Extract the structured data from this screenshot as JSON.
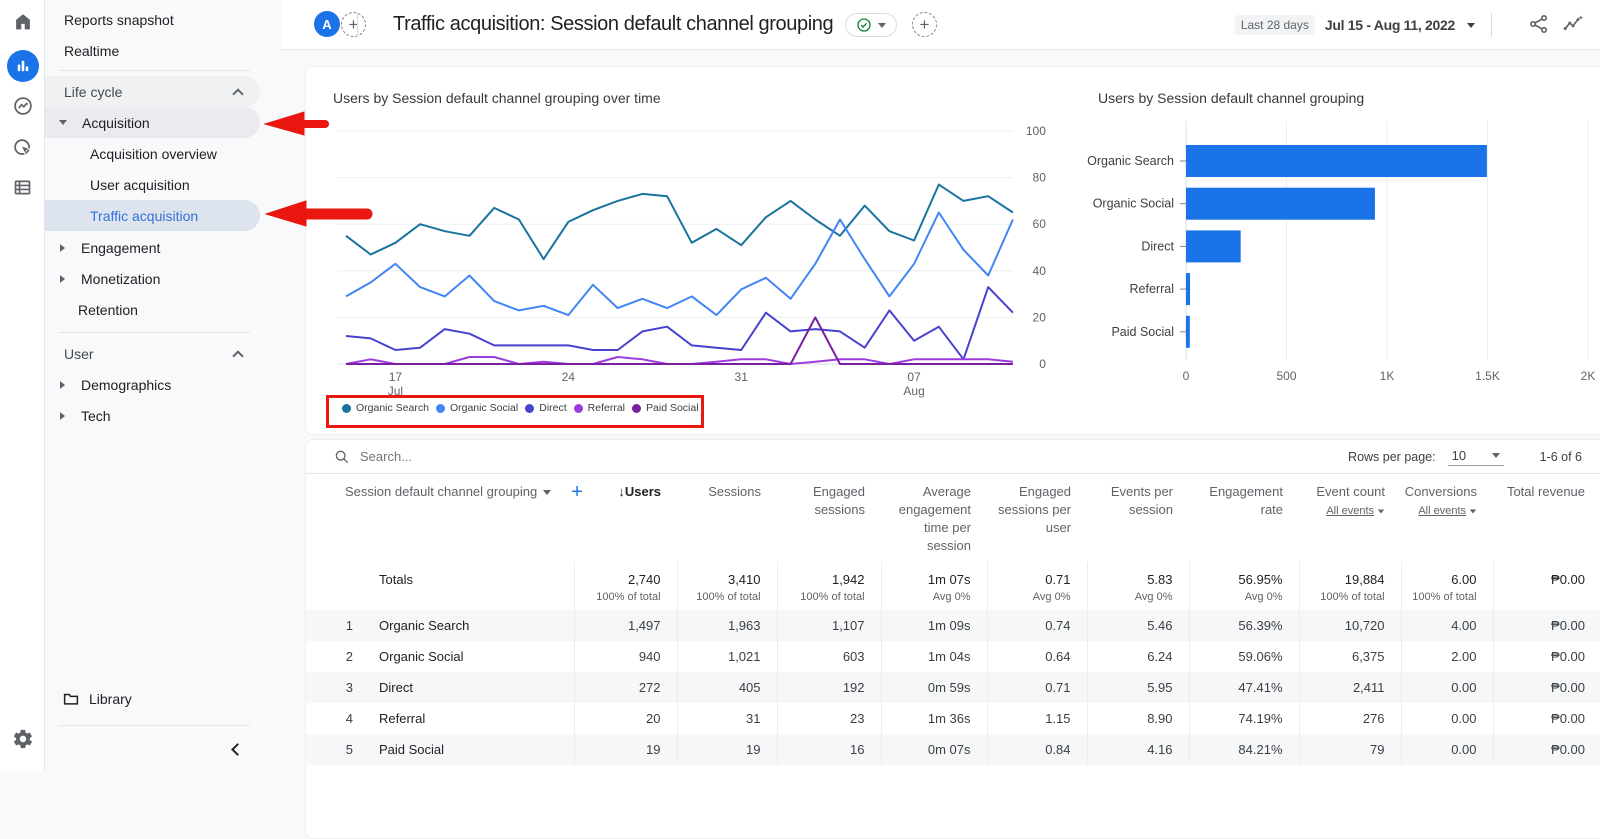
{
  "rail": {
    "icons": [
      {
        "name": "home"
      },
      {
        "name": "reports",
        "selected": true
      },
      {
        "name": "explore"
      },
      {
        "name": "advertising"
      },
      {
        "name": "configure"
      }
    ],
    "settings_icon": "admin-gear"
  },
  "sidebar": {
    "items": [
      {
        "label": "Reports snapshot"
      },
      {
        "label": "Realtime"
      },
      {
        "label": "Life cycle",
        "kind": "section"
      },
      {
        "label": "Acquisition",
        "kind": "group-expanded"
      },
      {
        "label": "Acquisition overview",
        "kind": "child"
      },
      {
        "label": "User acquisition",
        "kind": "child"
      },
      {
        "label": "Traffic acquisition",
        "kind": "child-selected"
      },
      {
        "label": "Engagement",
        "kind": "group"
      },
      {
        "label": "Monetization",
        "kind": "group"
      },
      {
        "label": "Retention",
        "kind": "plain"
      },
      {
        "label": "User",
        "kind": "section"
      },
      {
        "label": "Demographics",
        "kind": "group"
      },
      {
        "label": "Tech",
        "kind": "group"
      }
    ],
    "library_label": "Library"
  },
  "header": {
    "avatar_letter": "A",
    "title": "Traffic acquisition: Session default channel grouping",
    "date_chip": "Last 28 days",
    "date_range": "Jul 15 - Aug 11, 2022"
  },
  "chart_data": [
    {
      "type": "line",
      "title": "Users by Session default channel grouping over time",
      "ylabel": "",
      "ylim": [
        0,
        100
      ],
      "yticks": [
        0,
        20,
        40,
        60,
        80,
        100
      ],
      "x_days": 28,
      "x_ticks": [
        {
          "day": 2,
          "line1": "17",
          "line2": "Jul"
        },
        {
          "day": 9,
          "line1": "24",
          "line2": ""
        },
        {
          "day": 16,
          "line1": "31",
          "line2": ""
        },
        {
          "day": 23,
          "line1": "07",
          "line2": "Aug"
        }
      ],
      "legend_position": "bottom",
      "grid": true,
      "series": [
        {
          "name": "Organic Search",
          "color": "#18739e",
          "values": [
            55,
            47,
            52,
            60,
            57,
            55,
            67,
            62,
            45,
            61,
            66,
            70,
            73,
            72,
            52,
            58,
            51,
            63,
            70,
            62,
            55,
            68,
            57,
            53,
            77,
            70,
            72,
            65
          ]
        },
        {
          "name": "Organic Social",
          "color": "#4285f4",
          "values": [
            29,
            35,
            43,
            33,
            29,
            38,
            27,
            23,
            25,
            21,
            34,
            24,
            28,
            24,
            29,
            21,
            32,
            37,
            28,
            43,
            62,
            45,
            29,
            43,
            65,
            49,
            38,
            62
          ]
        },
        {
          "name": "Direct",
          "color": "#4742d0",
          "values": [
            12,
            11,
            6,
            7,
            15,
            13,
            8,
            8,
            8,
            8,
            6,
            6,
            14,
            16,
            8,
            7,
            6,
            22,
            14,
            15,
            14,
            7,
            23,
            10,
            16,
            2,
            33,
            22
          ]
        },
        {
          "name": "Referral",
          "color": "#9c3ce0",
          "values": [
            0,
            2,
            0,
            0,
            0,
            3,
            3,
            0,
            1,
            0,
            0,
            3,
            2,
            0,
            0,
            1,
            2,
            2,
            0,
            1,
            2,
            2,
            0,
            2,
            2,
            2,
            2,
            1
          ]
        },
        {
          "name": "Paid Social",
          "color": "#7b1fa2",
          "values": [
            0,
            0,
            0,
            0,
            0,
            0,
            0,
            0,
            0,
            0,
            0,
            0,
            0,
            0,
            0,
            0,
            0,
            0,
            0,
            20,
            0,
            0,
            0,
            0,
            0,
            0,
            0,
            0
          ]
        }
      ]
    },
    {
      "type": "bar",
      "title": "Users by Session default channel grouping",
      "categories": [
        "Organic Search",
        "Organic Social",
        "Direct",
        "Referral",
        "Paid Social"
      ],
      "values": [
        1497,
        940,
        272,
        20,
        19
      ],
      "bar_color": "#1a73e8",
      "xlim": [
        0,
        2000
      ],
      "x_ticks": [
        {
          "v": 0,
          "label": "0"
        },
        {
          "v": 500,
          "label": "500"
        },
        {
          "v": 1000,
          "label": "1K"
        },
        {
          "v": 1500,
          "label": "1.5K"
        },
        {
          "v": 2000,
          "label": "2K"
        }
      ],
      "grid": true
    }
  ],
  "table": {
    "search_placeholder": "Search...",
    "rows_per_page_label": "Rows per page:",
    "rows_per_page_value": "10",
    "range_label": "1-6 of 6",
    "dim_header": "Session default channel grouping",
    "columns": [
      {
        "label": "↓Users",
        "sorted": true
      },
      {
        "label": "Sessions"
      },
      {
        "label": "Engaged sessions"
      },
      {
        "label": "Average engagement time per session"
      },
      {
        "label": "Engaged sessions per user"
      },
      {
        "label": "Events per session"
      },
      {
        "label": "Engagement rate"
      },
      {
        "label": "Event count",
        "sublabel": "All events"
      },
      {
        "label": "Conversions",
        "sublabel": "All events"
      },
      {
        "label": "Total revenue"
      }
    ],
    "totals": {
      "label": "Totals",
      "values": [
        "2,740",
        "3,410",
        "1,942",
        "1m 07s",
        "0.71",
        "5.83",
        "56.95%",
        "19,884",
        "6.00",
        "₱0.00"
      ],
      "subs": [
        "100% of total",
        "100% of total",
        "100% of total",
        "Avg 0%",
        "Avg 0%",
        "Avg 0%",
        "Avg 0%",
        "100% of total",
        "100% of total",
        ""
      ]
    },
    "rows": [
      {
        "num": "1",
        "dim": "Organic Search",
        "cells": [
          "1,497",
          "1,963",
          "1,107",
          "1m 09s",
          "0.74",
          "5.46",
          "56.39%",
          "10,720",
          "4.00",
          "₱0.00"
        ]
      },
      {
        "num": "2",
        "dim": "Organic Social",
        "cells": [
          "940",
          "1,021",
          "603",
          "1m 04s",
          "0.64",
          "6.24",
          "59.06%",
          "6,375",
          "2.00",
          "₱0.00"
        ]
      },
      {
        "num": "3",
        "dim": "Direct",
        "cells": [
          "272",
          "405",
          "192",
          "0m 59s",
          "0.71",
          "5.95",
          "47.41%",
          "2,411",
          "0.00",
          "₱0.00"
        ]
      },
      {
        "num": "4",
        "dim": "Referral",
        "cells": [
          "20",
          "31",
          "23",
          "1m 36s",
          "1.15",
          "8.90",
          "74.19%",
          "276",
          "0.00",
          "₱0.00"
        ]
      },
      {
        "num": "5",
        "dim": "Paid Social",
        "cells": [
          "19",
          "19",
          "16",
          "0m 07s",
          "0.84",
          "4.16",
          "84.21%",
          "79",
          "0.00",
          "₱0.00"
        ]
      }
    ]
  },
  "annotations": {
    "arrow_color": "#ea1711",
    "legend_box_color": "#e8170f"
  }
}
